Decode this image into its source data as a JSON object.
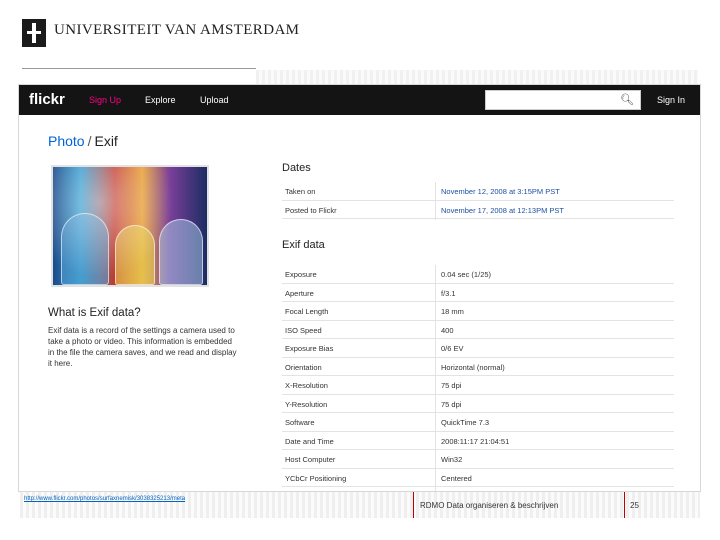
{
  "header": {
    "institution": "UNIVERSITEIT VAN AMSTERDAM"
  },
  "flickr": {
    "logo": "flickr",
    "nav": [
      "Sign Up",
      "Explore",
      "Upload"
    ],
    "search_icon": "search-icon",
    "signin": "Sign In"
  },
  "page": {
    "breadcrumb_photo": "Photo",
    "breadcrumb_sep": "/",
    "breadcrumb_current": "Exif",
    "exif_question": "What is Exif data?",
    "exif_description": "Exif data is a record of the settings a camera used to take a photo or video. This information is embedded in the file the camera saves, and we read and display it here."
  },
  "dates": {
    "title": "Dates",
    "rows": [
      {
        "label": "Taken on",
        "value": "November 12, 2008 at 3:15PM PST"
      },
      {
        "label": "Posted to Flickr",
        "value": "November 17, 2008 at 12:13PM PST"
      }
    ]
  },
  "exif": {
    "title": "Exif data",
    "rows": [
      {
        "label": "Exposure",
        "value": "0.04 sec (1/25)"
      },
      {
        "label": "Aperture",
        "value": "f/3.1"
      },
      {
        "label": "Focal Length",
        "value": "18 mm"
      },
      {
        "label": "ISO Speed",
        "value": "400"
      },
      {
        "label": "Exposure Bias",
        "value": "0/6 EV"
      },
      {
        "label": "Orientation",
        "value": "Horizontal (normal)"
      },
      {
        "label": "X-Resolution",
        "value": "75 dpi"
      },
      {
        "label": "Y-Resolution",
        "value": "75 dpi"
      },
      {
        "label": "Software",
        "value": "QuickTime 7.3"
      },
      {
        "label": "Date and Time",
        "value": "2008:11:17 21:04:51"
      },
      {
        "label": "Host Computer",
        "value": "Win32"
      },
      {
        "label": "YCbCr Positioning",
        "value": "Centered"
      }
    ]
  },
  "footer": {
    "url": "http://www.flickr.com/photos/surfaxnemisk/3038325213/meta",
    "title": "RDMO Data organiseren & beschrijven",
    "page": "25"
  }
}
